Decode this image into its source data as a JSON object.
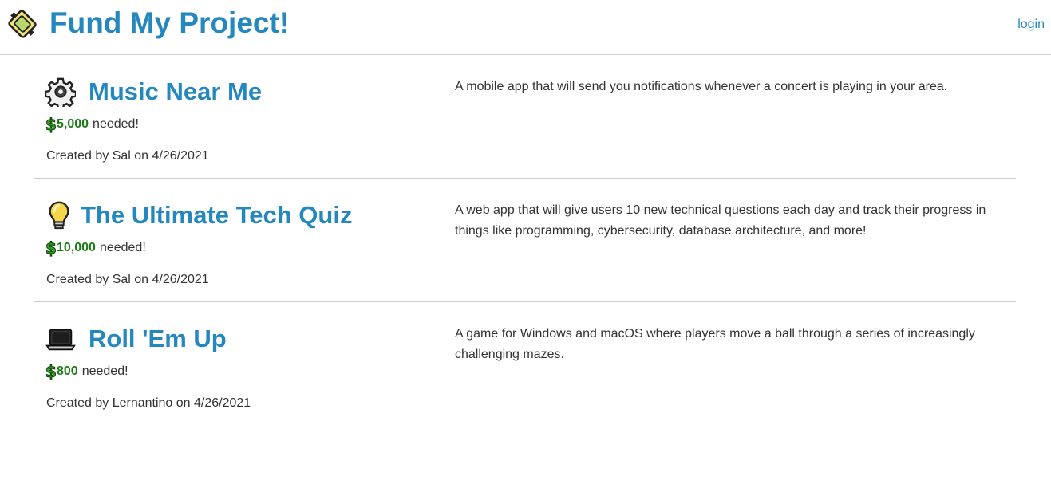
{
  "header": {
    "title": "Fund My Project!",
    "login_label": "login",
    "logo_icon": "project-logo-icon"
  },
  "colors": {
    "accent": "#2488bf",
    "amount": "#1d7a16",
    "divider": "#cfcfcf"
  },
  "projects": [
    {
      "icon": "gear-icon",
      "title": "Music Near Me",
      "amount": "5,000",
      "needed_label": "needed!",
      "created": "Created by Sal on 4/26/2021",
      "description": "A mobile app that will send you notifications whenever a concert is playing in your area."
    },
    {
      "icon": "lightbulb-icon",
      "title": "The Ultimate Tech Quiz",
      "amount": "10,000",
      "needed_label": "needed!",
      "created": "Created by Sal on 4/26/2021",
      "description": "A web app that will give users 10 new technical questions each day and track their progress in things like programming, cybersecurity, database architecture, and more!"
    },
    {
      "icon": "laptop-icon",
      "title": "Roll 'Em Up",
      "amount": "800",
      "needed_label": "needed!",
      "created": "Created by Lernantino on 4/26/2021",
      "description": "A game for Windows and macOS where players move a ball through a series of increasingly challenging mazes."
    }
  ]
}
